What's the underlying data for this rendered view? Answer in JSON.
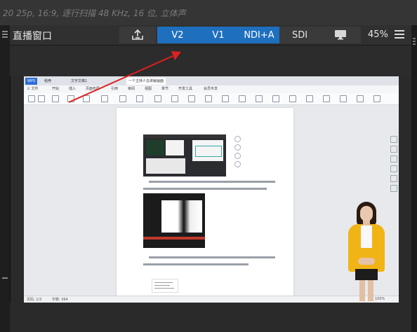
{
  "header": {
    "format_info": "20 25p, 16:9, 逐行扫描 48 KHz, 16 位, 立体声"
  },
  "toolbar": {
    "title": "直播窗口",
    "v2_label": "V2",
    "v1_label": "V1",
    "ndi_label": "NDI+A",
    "sdi_label": "SDI",
    "zoom_label": "45%"
  },
  "preview": {
    "wps_tabs": [
      "WPS",
      "稻壳",
      "文字文稿1",
      "一个主持人在讲解画面"
    ],
    "wps_menu": [
      "三 文件",
      "开始",
      "插入",
      "页面布局",
      "引用",
      "审阅",
      "视图",
      "章节",
      "开发工具",
      "会员专享"
    ],
    "status_left": "页码: 1/3",
    "status_mid": "字数: 364",
    "status_right": "100%"
  },
  "colors": {
    "accent_blue": "#1f6fbf",
    "arrow_red": "#e02020",
    "presenter_jacket": "#f1b417"
  },
  "icons": [
    "upload-icon",
    "monitor-icon",
    "menu-icon"
  ]
}
